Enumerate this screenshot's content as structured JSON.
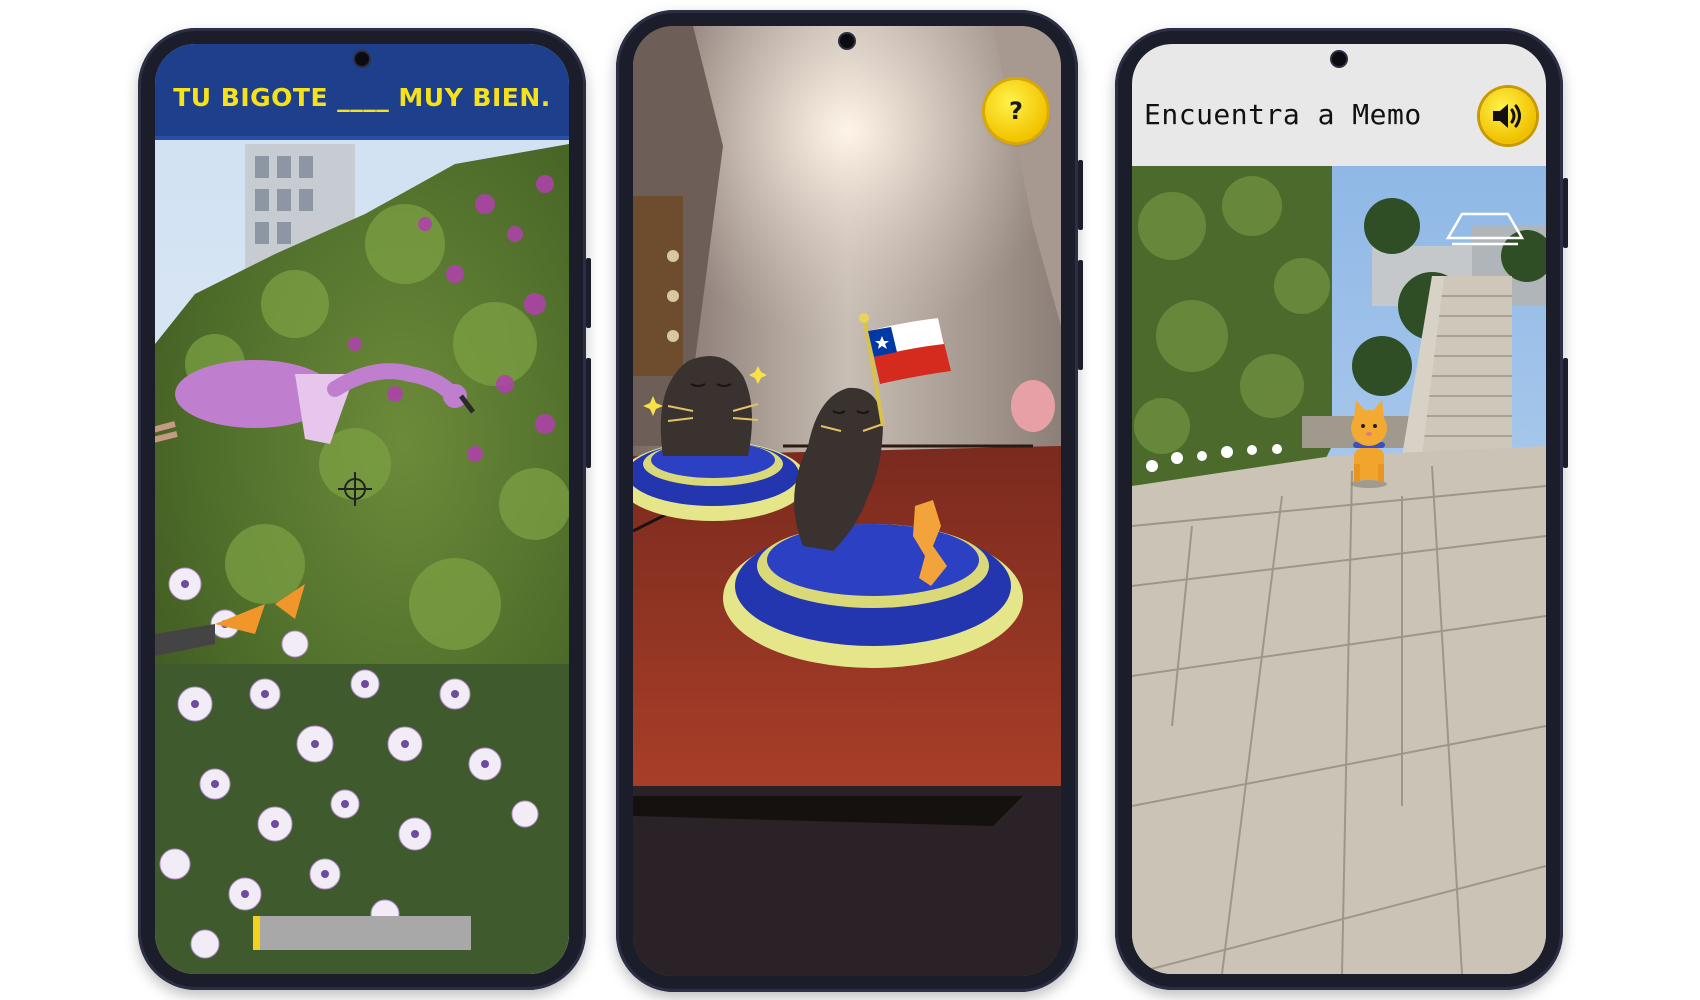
{
  "phones": [
    {
      "banner_text": "TU BIGOTE ____ MUY BIEN.",
      "progress_fraction": 0.03
    },
    {
      "help_button_label": "?"
    },
    {
      "title": "Encuentra a Memo",
      "sound_icon": "speaker-icon"
    }
  ],
  "colors": {
    "banner_bg": "#1e3f8c",
    "banner_text": "#f6e21b",
    "button_yellow": "#f2c400",
    "header_gray": "#e8e8e8"
  }
}
